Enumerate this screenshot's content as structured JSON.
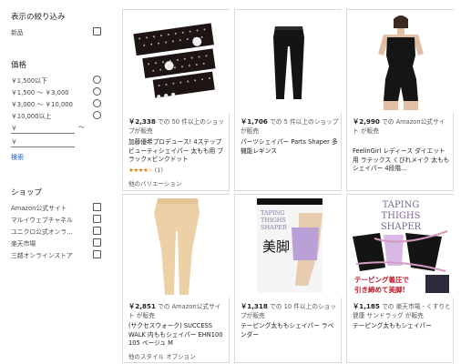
{
  "filters": {
    "display_title": "表示の絞り込み",
    "new_label": "新品",
    "price_title": "価格",
    "price_ranges": [
      "￥1,500以下",
      "￥1,500 ～ ￥3,000",
      "￥3,000 ～ ￥10,000",
      "￥10,000以上"
    ],
    "yen_symbol": "￥",
    "tilde": "～",
    "search_label": "検索",
    "shop_title": "ショップ",
    "shops": [
      "Amazon公式サイト",
      "マルイウェブチャネル",
      "ユニクロ公式オンラ...",
      "楽天市場",
      "三越オンラインストア"
    ]
  },
  "products": [
    {
      "price": "￥2,338",
      "seller": "での 50 件以上のショップが販売",
      "title": "加藤優希プロデュース! 4ステップ ビューティシェイパー 太もも用 ブラック×ピンクドット",
      "stars": "★★★★☆",
      "rating_count": "(1)",
      "variation": "他のバリエーション"
    },
    {
      "price": "￥1,706",
      "seller": "での 5 件以上のショップが販売",
      "title": "パーツシェイパー Parts Shaper 多機能レギンス"
    },
    {
      "price": "￥2,990",
      "seller": "での Amazon公式サイト が販売",
      "title": "FeelinGirl レディース ダイエット用 ラテックス くびれメイク 太ももシェイパー 4段階..."
    },
    {
      "price": "￥2,851",
      "seller": "での Amazon公式サイト が販売",
      "title": "(サクセスウォーク) SUCCESS WALK 内ももシェイパー EHN100 105 ベージュ M",
      "variation": "他のスタイル オプション"
    },
    {
      "price": "￥1,318",
      "seller": "での 10 件以上のショップが販売",
      "title": "テーピング太ももシェイパー ラベンダー",
      "package_text": [
        "TAPING",
        "THIGHS",
        "SHAPER",
        "美脚"
      ]
    },
    {
      "price": "￥1,185",
      "seller": "での 楽天市場 - くすりと健康 サンドラッグ が販売",
      "title": "テーピング太ももシェイパー",
      "package_text": [
        "TAPING",
        "THIGHS",
        "SHAPER",
        "テーピング着圧で",
        "引き締めて美脚!"
      ]
    }
  ]
}
